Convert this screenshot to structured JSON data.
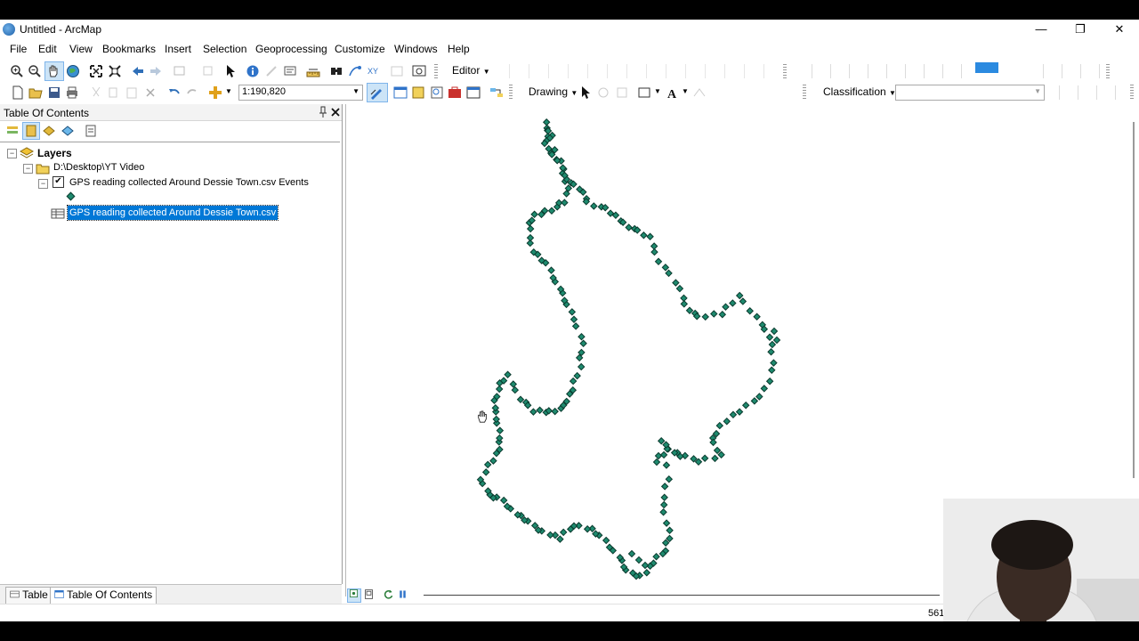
{
  "window": {
    "title": "Untitled - ArcMap",
    "controls": [
      "minimize",
      "restore",
      "close"
    ]
  },
  "menu": [
    "File",
    "Edit",
    "View",
    "Bookmarks",
    "Insert",
    "Selection",
    "Geoprocessing",
    "Customize",
    "Windows",
    "Help"
  ],
  "toolbar": {
    "editor_label": "Editor",
    "scale_value": "1:190,820",
    "drawing_label": "Drawing",
    "classification_label": "Classification",
    "classification_value": ""
  },
  "toc": {
    "title": "Table Of Contents",
    "root_label": "Layers",
    "folder_path": "D:\\Desktop\\YT Video",
    "layer_name": "GPS reading collected Around Dessie Town.csv Events",
    "table_name": "GPS reading collected Around Dessie Town.csv",
    "layer_visible": true
  },
  "bottom_tabs": {
    "table": "Table",
    "toc": "Table Of Contents"
  },
  "status": {
    "coords": "561"
  },
  "colors": {
    "point_fill": "#1e8a6e",
    "point_stroke": "#0b3a2e",
    "selection": "#0078d7"
  },
  "icons": [
    "zoom-in-icon",
    "zoom-out-icon",
    "pan-icon",
    "full-extent-icon",
    "identify-icon",
    "find-icon",
    "pointer-icon",
    "add-data-icon",
    "save-icon",
    "open-icon",
    "undo-icon",
    "redo-icon",
    "hand-cursor-icon"
  ]
}
